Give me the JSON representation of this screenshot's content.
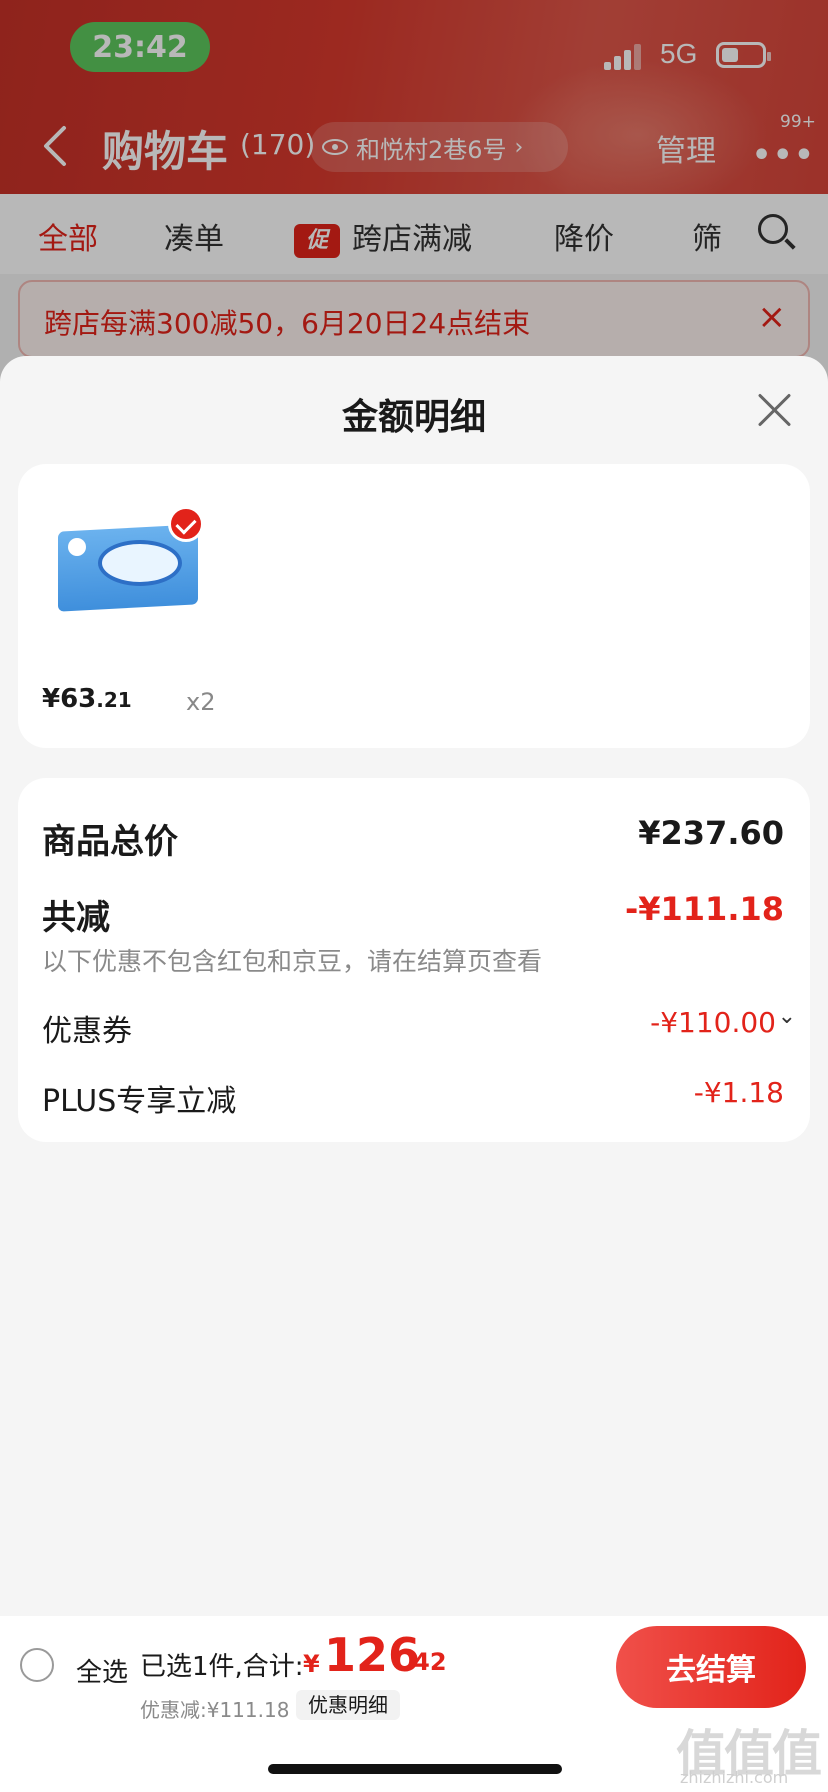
{
  "status_bar": {
    "time": "23:42",
    "network": "5G"
  },
  "nav": {
    "title": "购物车",
    "count": "(170)",
    "address": "和悦村2巷6号",
    "manage": "管理",
    "more_badge": "99+"
  },
  "tabs": [
    {
      "label": "全部",
      "active": true
    },
    {
      "label": "凑单"
    },
    {
      "label": "跨店满减",
      "tag": "促"
    },
    {
      "label": "降价"
    },
    {
      "label": "筛"
    }
  ],
  "notice": {
    "text": "跨店每满300减50，6月20日24点结束"
  },
  "sheet": {
    "title": "金额明细",
    "product": {
      "price_main": "¥63",
      "price_cents": ".21",
      "quantity": "x2"
    },
    "summary": {
      "total_label": "商品总价",
      "total_value": "¥237.60",
      "reduce_label": "共减",
      "reduce_value": "-¥111.18",
      "reduce_note": "以下优惠不包含红包和京豆，请在结算页查看",
      "coupon_label": "优惠券",
      "coupon_value": "-¥110.00",
      "plus_label": "PLUS专享立减",
      "plus_value": "-¥1.18"
    }
  },
  "checkout": {
    "select_all": "全选",
    "selected_summary": "已选1件,合计:",
    "currency": "¥",
    "total_main": "126",
    "total_cents": ".42",
    "discount": "优惠减:¥111.18",
    "detail_link": "优惠明细",
    "button": "去结算"
  },
  "watermark": {
    "text": "值值值",
    "url": "zhizhizhi.com"
  },
  "colors": {
    "brand_red": "#e2231a",
    "header_red": "#d8392d",
    "sheet_bg": "#f5f5f5"
  }
}
